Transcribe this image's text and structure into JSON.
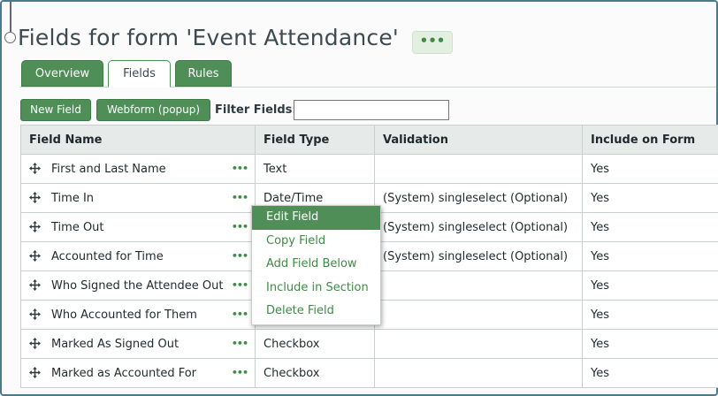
{
  "header": {
    "title": "Fields for form 'Event Attendance'",
    "menu_glyph": "•••"
  },
  "tabs": [
    {
      "label": "Overview",
      "state": "inactive"
    },
    {
      "label": "Fields",
      "state": "active"
    },
    {
      "label": "Rules",
      "state": "inactive"
    }
  ],
  "toolbar": {
    "new_field_label": "New Field",
    "webform_label": "Webform (popup)",
    "filter_label": "Filter Fields:",
    "filter_value": ""
  },
  "table": {
    "columns": [
      "Field Name",
      "Field Type",
      "Validation",
      "Include on Form"
    ],
    "rows": [
      {
        "name": "First and Last Name",
        "type": "Text",
        "validation": "",
        "include": "Yes"
      },
      {
        "name": "Time In",
        "type": "Date/Time",
        "validation": "(System) singleselect (Optional)",
        "include": "Yes"
      },
      {
        "name": "Time Out",
        "type": "",
        "validation": "(System) singleselect (Optional)",
        "include": "Yes"
      },
      {
        "name": "Accounted for Time",
        "type": "",
        "validation": "(System) singleselect (Optional)",
        "include": "Yes"
      },
      {
        "name": "Who Signed the Attendee Out",
        "type": "",
        "validation": "",
        "include": "Yes"
      },
      {
        "name": "Who Accounted for Them",
        "type": "",
        "validation": "",
        "include": "Yes"
      },
      {
        "name": "Marked As Signed Out",
        "type": "Checkbox",
        "validation": "",
        "include": "Yes"
      },
      {
        "name": "Marked as Accounted For",
        "type": "Checkbox",
        "validation": "",
        "include": "Yes"
      }
    ],
    "row_menu_glyph": "•••"
  },
  "context_menu": {
    "items": [
      {
        "label": "Edit Field",
        "highlighted": true
      },
      {
        "label": "Copy Field",
        "highlighted": false
      },
      {
        "label": "Add Field Below",
        "highlighted": false
      },
      {
        "label": "Include in Section",
        "highlighted": false
      },
      {
        "label": "Delete Field",
        "highlighted": false
      }
    ]
  },
  "colors": {
    "accent_green": "#4f8f57",
    "header_bg": "#e6ebe9",
    "frame_border": "#4b7a8c"
  },
  "icons": {
    "drag_handle": "move-arrows-icon",
    "row_menu": "ellipsis-icon",
    "title_menu": "ellipsis-icon"
  }
}
